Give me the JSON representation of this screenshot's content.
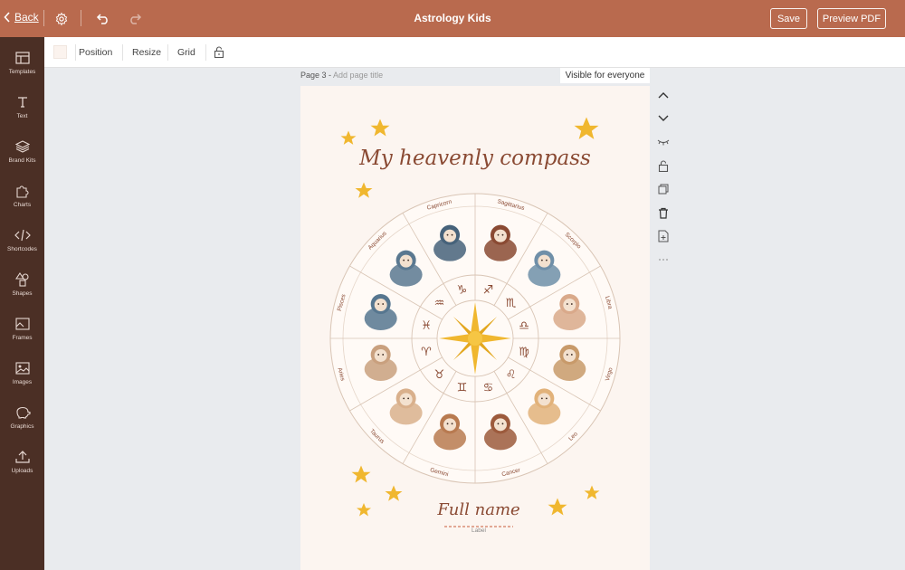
{
  "header": {
    "back_label": "Back",
    "title": "Astrology Kids",
    "save_label": "Save",
    "preview_label": "Preview PDF",
    "icons": [
      "chevron-left-icon",
      "gear-icon",
      "undo-icon",
      "redo-icon"
    ]
  },
  "sidebar": {
    "items": [
      {
        "label": "Templates",
        "icon": "templates-icon"
      },
      {
        "label": "Text",
        "icon": "text-icon"
      },
      {
        "label": "Brand Kits",
        "icon": "layers-icon"
      },
      {
        "label": "Charts",
        "icon": "puzzle-icon"
      },
      {
        "label": "Shortcodes",
        "icon": "code-icon"
      },
      {
        "label": "Shapes",
        "icon": "shapes-icon"
      },
      {
        "label": "Frames",
        "icon": "frame-icon"
      },
      {
        "label": "Images",
        "icon": "image-icon"
      },
      {
        "label": "Graphics",
        "icon": "piggy-icon"
      },
      {
        "label": "Uploads",
        "icon": "upload-icon"
      }
    ]
  },
  "toolbar": {
    "position_label": "Position",
    "resize_label": "Resize",
    "grid_label": "Grid",
    "swatch_color": "#fbf3ee"
  },
  "page": {
    "label": "Page 3 -",
    "title_placeholder": "Add page title",
    "visibility": "Visible for everyone",
    "canvas": {
      "heading": "My heavenly compass",
      "signs": [
        "Capricorn",
        "Sagittarius",
        "Scorpio",
        "Libra",
        "Virgo",
        "Leo",
        "Cancer",
        "Gemini",
        "Taurus",
        "Aries",
        "Pisces",
        "Aquarius"
      ],
      "glyphs": [
        "♑",
        "♐",
        "♏",
        "♎",
        "♍",
        "♌",
        "♋",
        "♊",
        "♉",
        "♈",
        "♓",
        "♒"
      ],
      "name_text": "Full name",
      "name_label": "Label"
    }
  },
  "rail": {
    "icons": [
      "chevron-up-icon",
      "chevron-down-icon",
      "eye-closed-icon",
      "lock-icon",
      "duplicate-icon",
      "trash-icon",
      "add-page-icon",
      "more-icon"
    ]
  },
  "colors": {
    "header_bg": "#b96a4e",
    "sidebar_bg": "#4b2f25",
    "canvas_bg": "#fcf5f0",
    "accent_brown": "#8a4a33",
    "star_yellow": "#f0b72f"
  }
}
